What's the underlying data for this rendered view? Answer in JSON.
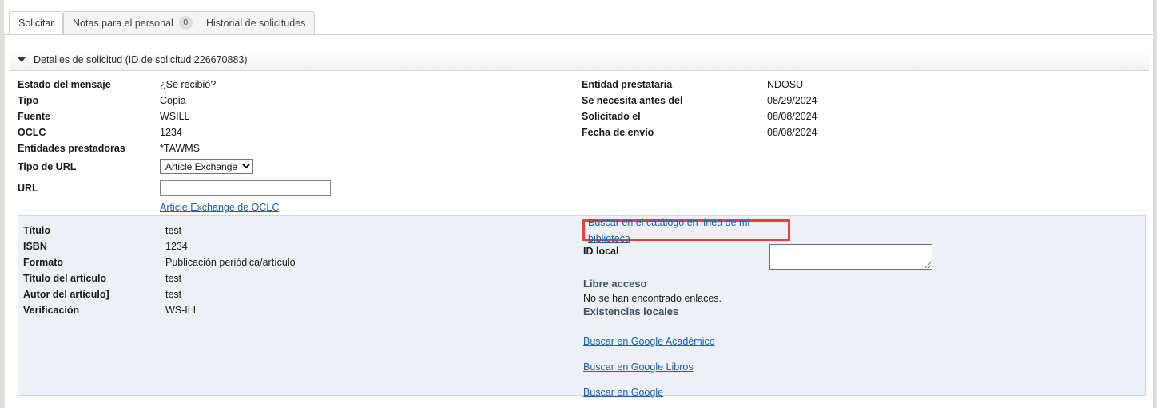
{
  "tabs": [
    {
      "label": "Solicitar",
      "active": true,
      "badge": null
    },
    {
      "label": "Notas para el personal",
      "active": false,
      "badge": "0"
    },
    {
      "label": "Historial de solicitudes",
      "active": false,
      "badge": null
    }
  ],
  "section": {
    "title": "Detalles de solicitud (ID de solicitud 226670883)",
    "caret": "chevron-down-icon"
  },
  "details_left": [
    {
      "label": "Estado del mensaje",
      "value": "¿Se recibió?"
    },
    {
      "label": "Tipo",
      "value": "Copia"
    },
    {
      "label": "Fuente",
      "value": "WSILL"
    },
    {
      "label": "OCLC",
      "value": "1234"
    },
    {
      "label": "Entidades prestadoras",
      "value": "*TAWMS"
    }
  ],
  "details_right": [
    {
      "label": "Entidad prestataria",
      "value": "NDOSU"
    },
    {
      "label": "Se necesita antes del",
      "value": "08/29/2024"
    },
    {
      "label": "Solicitado el",
      "value": "08/08/2024"
    },
    {
      "label": "Fecha de envío",
      "value": "08/08/2024"
    }
  ],
  "url_type": {
    "label": "Tipo de URL",
    "selected": "Article Exchange",
    "options": [
      "Article Exchange"
    ]
  },
  "url_field": {
    "label": "URL",
    "value": "",
    "placeholder": ""
  },
  "article_exchange_link": "Article Exchange de OCLC",
  "bibliographic": [
    {
      "label": "Título",
      "value": "test"
    },
    {
      "label": "ISBN",
      "value": "1234"
    },
    {
      "label": "Formato",
      "value": "Publicación periódica/artículo"
    },
    {
      "label": "Título del artículo",
      "value": "test"
    },
    {
      "label": "Autor del artículo]",
      "value": "test"
    },
    {
      "label": "Verificación",
      "value": "WS-ILL"
    }
  ],
  "catalog": {
    "link_label": "Buscar en el catálogo en línea de mi biblioteca",
    "highlight_color": "#e8403a"
  },
  "id_local": {
    "label": "ID local",
    "value": "",
    "placeholder": ""
  },
  "open_access": {
    "heading": "Libre acceso",
    "message": "No se han encontrado enlaces."
  },
  "local_holdings": {
    "heading": "Existencias locales"
  },
  "search_links": [
    "Buscar en Google Académico",
    "Buscar en Google Libros",
    "Buscar en Google"
  ],
  "colors": {
    "link": "#1a5fb4",
    "panel_bg": "#edf1f5",
    "panel_border": "#c6d9e8",
    "heading": "#3b5368"
  }
}
